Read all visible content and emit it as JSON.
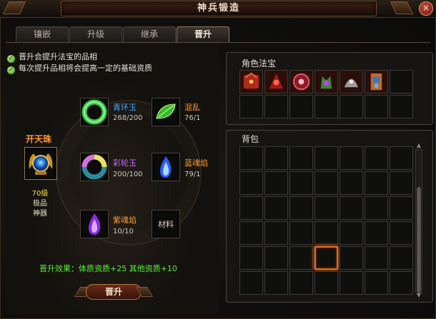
{
  "window": {
    "title": "神兵锻造",
    "close_glyph": "×"
  },
  "tabs": [
    {
      "label": "镶嵌",
      "active": false
    },
    {
      "label": "升级",
      "active": false
    },
    {
      "label": "继承",
      "active": false
    },
    {
      "label": "晋升",
      "active": true
    }
  ],
  "notes": [
    "晋升会提升法宝的品相",
    "每次提升品相将会提高一定的基础资质"
  ],
  "main_item": {
    "name": "开天珠",
    "level": "70级",
    "quality": "极品",
    "type": "神器"
  },
  "materials": [
    {
      "name": "青环玉",
      "count": "268/200",
      "color": "#4aa8ff",
      "icon": "green-ring-jade-icon"
    },
    {
      "name": "混乱",
      "count": "76/1",
      "color": "#ff9a2a",
      "icon": "green-leaf-gem-icon"
    },
    {
      "name": "彩轮玉",
      "count": "200/100",
      "color": "#c46aff",
      "icon": "rainbow-wheel-jade-icon"
    },
    {
      "name": "蓝魂焰",
      "count": "79/1",
      "color": "#ff9a2a",
      "icon": "blue-soul-flame-icon"
    },
    {
      "name": "紫魂焰",
      "count": "10/10",
      "color": "#ff9a2a",
      "icon": "purple-soul-flame-icon"
    }
  ],
  "material_slot_label": "材料",
  "effect_text": "晋升效果：体质资质+25 其他资质+10",
  "upgrade_button": "晋升",
  "treasure_panel": {
    "title": "角色法宝",
    "items": [
      "red-beast-armor-icon",
      "red-demon-armor-icon",
      "red-orb-icon",
      "green-demon-icon",
      "silver-beast-icon",
      "blue-totem-icon"
    ]
  },
  "bag_panel": {
    "title": "背包"
  }
}
